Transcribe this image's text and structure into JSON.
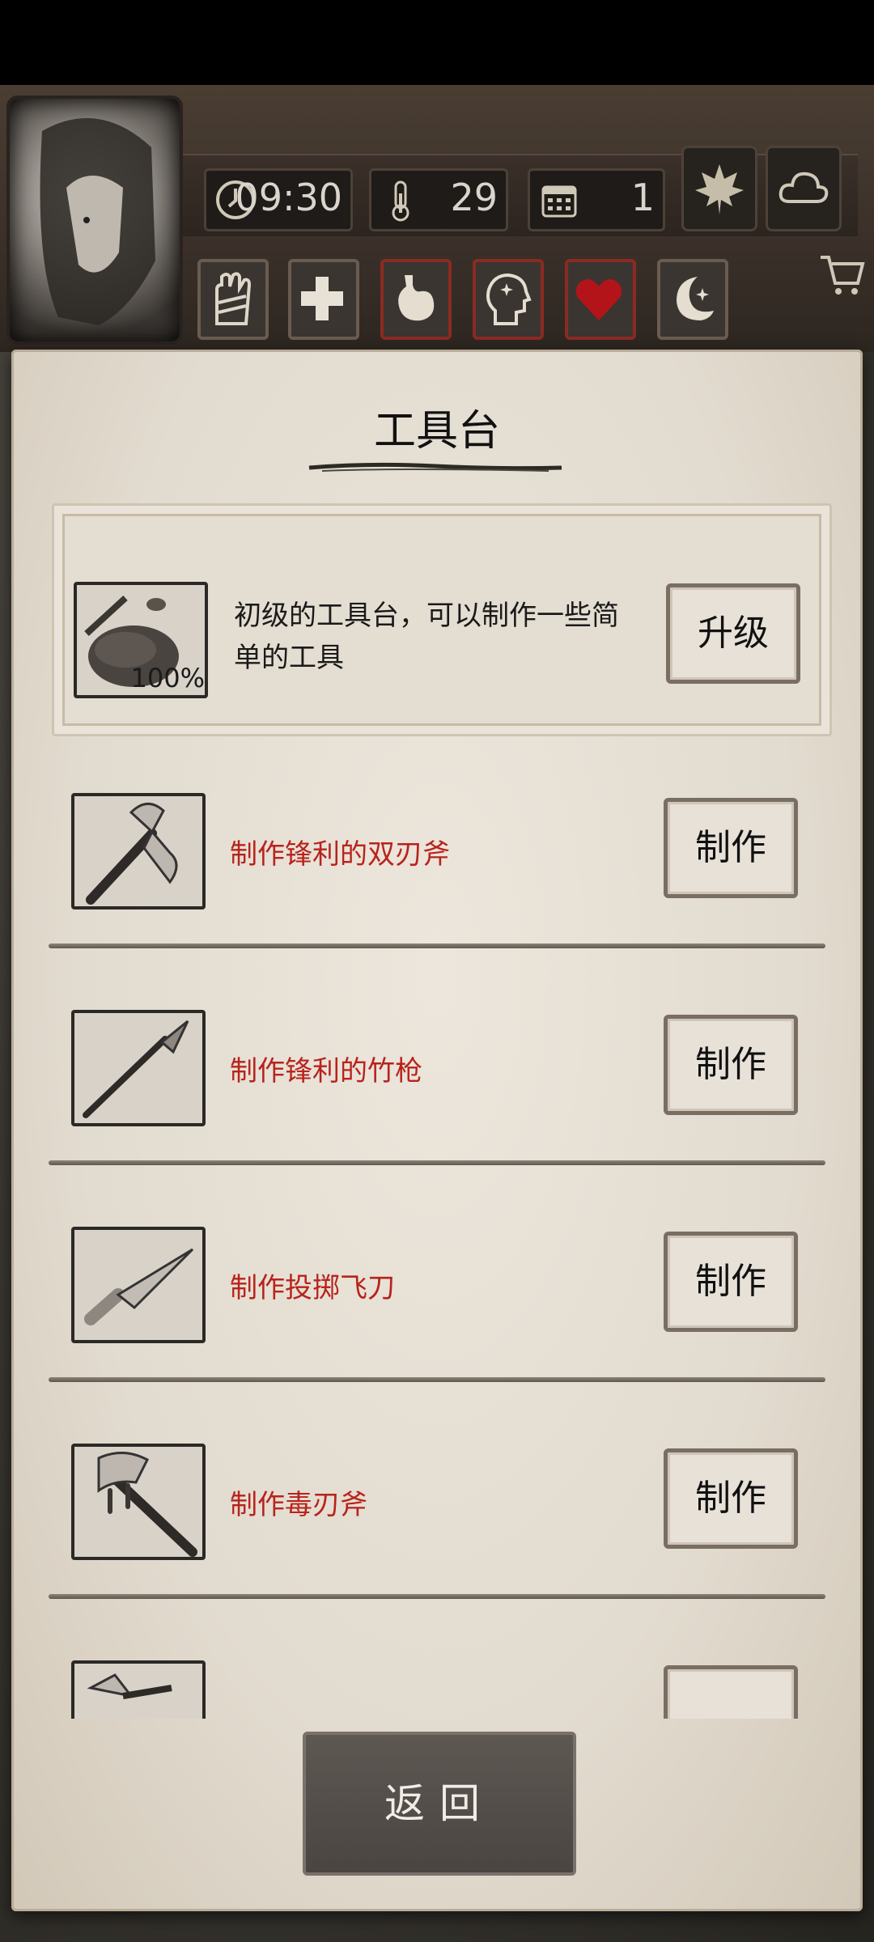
{
  "hud": {
    "time": "09:30",
    "temperature": "29",
    "day": "1",
    "icons": {
      "time": "clock-icon",
      "temperature": "thermometer-icon",
      "day": "calendar-icon",
      "season": "maple-leaf-icon",
      "weather": "cloud-icon",
      "shop": "cart-icon"
    },
    "status_icons": [
      "hand-bandage-icon",
      "health-cross-icon",
      "stomach-icon",
      "sanity-head-icon",
      "heart-icon",
      "moon-sleep-icon"
    ]
  },
  "panel": {
    "title": "工具台",
    "upgrade": {
      "description_line1": "初级的工具台，可以制作一些简",
      "description_line2": "单的工具",
      "progress": "100%",
      "button": "升级"
    },
    "items": [
      {
        "name": "制作锋利的双刃斧",
        "button": "制作",
        "icon": "double-axe-icon"
      },
      {
        "name": "制作锋利的竹枪",
        "button": "制作",
        "icon": "bamboo-spear-icon"
      },
      {
        "name": "制作投掷飞刀",
        "button": "制作",
        "icon": "throwing-knife-icon"
      },
      {
        "name": "制作毒刃斧",
        "button": "制作",
        "icon": "poison-axe-icon"
      }
    ]
  },
  "back_label": "返回",
  "colors": {
    "item_name": "#b8231c",
    "parchment": "#e2dbcf",
    "hud_wood": "#3a3029"
  }
}
